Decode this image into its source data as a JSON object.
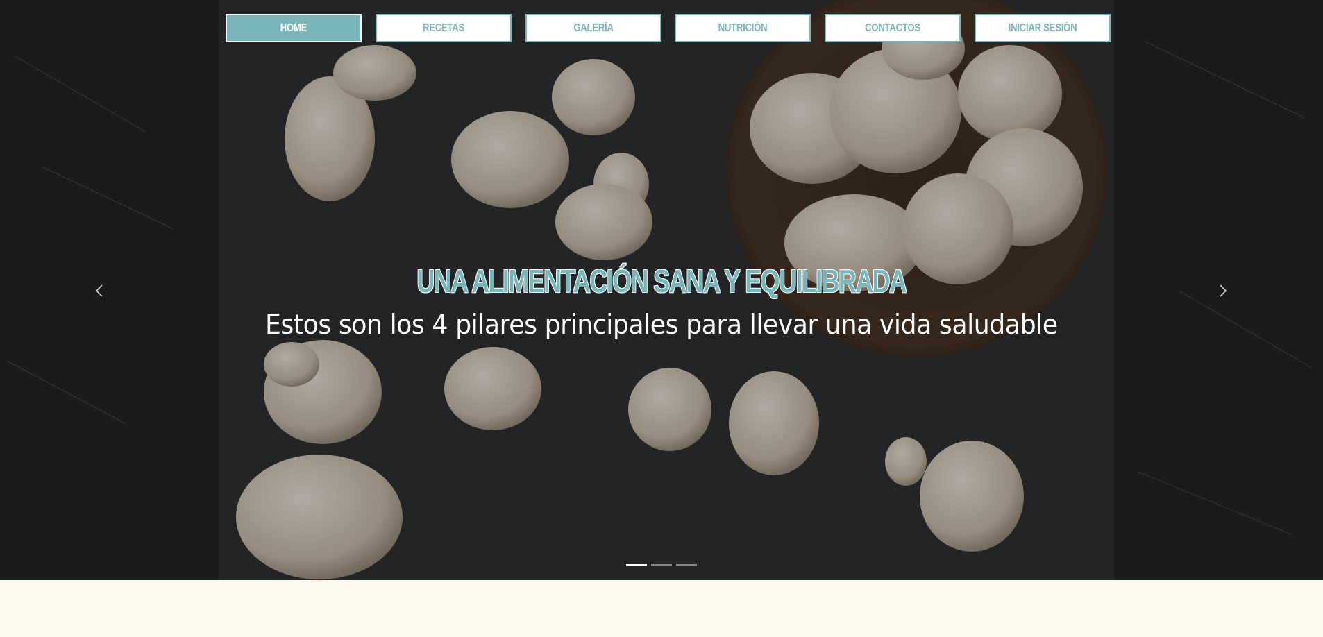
{
  "nav": {
    "items": [
      {
        "label": "HOME",
        "active": true
      },
      {
        "label": "RECETAS",
        "active": false
      },
      {
        "label": "GALERÍA",
        "active": false
      },
      {
        "label": "NUTRICIÓN",
        "active": false
      },
      {
        "label": "CONTACTOS",
        "active": false
      },
      {
        "label": "INICIAR SESIÓN",
        "active": false
      }
    ]
  },
  "carousel": {
    "headline": "UNA ALIMENTACIÓN SANA Y EQUILIBRADA",
    "subline": "Estos son los 4 pilares principales para llevar una vida saludable",
    "prev_icon": "chevron-left-icon",
    "next_icon": "chevron-right-icon",
    "slide_count": 3,
    "active_slide": 1
  },
  "colors": {
    "accent": "#7ab5b9",
    "hero_dark": "#2e3032",
    "page_bg": "#fdf9ef"
  }
}
